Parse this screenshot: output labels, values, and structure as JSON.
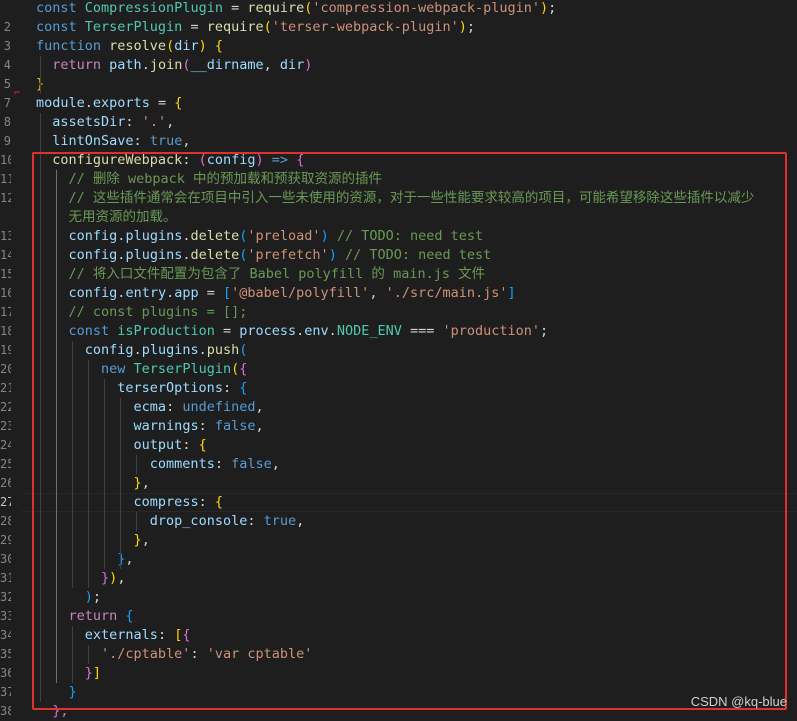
{
  "editor": {
    "current_line": "27",
    "lines": [
      {
        "n": "",
        "tokens": [
          [
            "k",
            "const "
          ],
          [
            "c",
            "CompressionPlugin"
          ],
          [
            "p",
            " = "
          ],
          [
            "f",
            "require"
          ],
          [
            "b1",
            "("
          ],
          [
            "s",
            "'compression-webpack-plugin'"
          ],
          [
            "b1",
            ")"
          ],
          [
            "p",
            ";"
          ]
        ]
      },
      {
        "n": "2",
        "tokens": [
          [
            "k",
            "const "
          ],
          [
            "c",
            "TerserPlugin"
          ],
          [
            "p",
            " = "
          ],
          [
            "f",
            "require"
          ],
          [
            "b1",
            "("
          ],
          [
            "s",
            "'terser-webpack-plugin'"
          ],
          [
            "b1",
            ")"
          ],
          [
            "p",
            ";"
          ]
        ]
      },
      {
        "n": "3",
        "tokens": [
          [
            "k",
            "function "
          ],
          [
            "f",
            "resolve"
          ],
          [
            "b1",
            "("
          ],
          [
            "v",
            "dir"
          ],
          [
            "b1",
            ")"
          ],
          [
            "p",
            " "
          ],
          [
            "b1",
            "{"
          ]
        ]
      },
      {
        "n": "4",
        "tokens": [
          [
            "p",
            "  "
          ],
          [
            "kc",
            "return "
          ],
          [
            "v",
            "path"
          ],
          [
            "p",
            "."
          ],
          [
            "f",
            "join"
          ],
          [
            "b2",
            "("
          ],
          [
            "v",
            "__dirname"
          ],
          [
            "p",
            ", "
          ],
          [
            "v",
            "dir"
          ],
          [
            "b2",
            ")"
          ]
        ]
      },
      {
        "n": "5",
        "tokens": [
          [
            "b1",
            "}"
          ]
        ]
      },
      {
        "n": "7",
        "tokens": [
          [
            "v",
            "module"
          ],
          [
            "p",
            "."
          ],
          [
            "v",
            "exports"
          ],
          [
            "p",
            " = "
          ],
          [
            "b1",
            "{"
          ]
        ]
      },
      {
        "n": "8",
        "tokens": [
          [
            "p",
            "  "
          ],
          [
            "v",
            "assetsDir"
          ],
          [
            "p",
            ": "
          ],
          [
            "s",
            "'.'"
          ],
          [
            "p",
            ","
          ]
        ]
      },
      {
        "n": "9",
        "tokens": [
          [
            "p",
            "  "
          ],
          [
            "v",
            "lintOnSave"
          ],
          [
            "p",
            ": "
          ],
          [
            "k",
            "true"
          ],
          [
            "p",
            ","
          ]
        ]
      },
      {
        "n": "10",
        "tokens": [
          [
            "p",
            "  "
          ],
          [
            "f",
            "configureWebpack"
          ],
          [
            "p",
            ": "
          ],
          [
            "b2",
            "("
          ],
          [
            "v",
            "config"
          ],
          [
            "b2",
            ")"
          ],
          [
            "p",
            " "
          ],
          [
            "k",
            "=>"
          ],
          [
            "p",
            " "
          ],
          [
            "b2",
            "{"
          ]
        ]
      },
      {
        "n": "11",
        "tokens": [
          [
            "cm",
            "    // 删除 webpack 中的预加载和预获取资源的插件"
          ]
        ]
      },
      {
        "n": "12",
        "tokens": [
          [
            "cm",
            "    // 这些插件通常会在项目中引入一些未使用的资源，对于一些性能要求较高的项目，可能希望移除这些插件以减少"
          ]
        ]
      },
      {
        "n": "",
        "tokens": [
          [
            "cm",
            "    无用资源的加载。"
          ]
        ]
      },
      {
        "n": "13",
        "tokens": [
          [
            "p",
            "    "
          ],
          [
            "v",
            "config"
          ],
          [
            "p",
            "."
          ],
          [
            "v",
            "plugins"
          ],
          [
            "p",
            "."
          ],
          [
            "f",
            "delete"
          ],
          [
            "b3",
            "("
          ],
          [
            "s",
            "'preload'"
          ],
          [
            "b3",
            ")"
          ],
          [
            "cm",
            " // TODO: need test"
          ]
        ]
      },
      {
        "n": "14",
        "tokens": [
          [
            "p",
            "    "
          ],
          [
            "v",
            "config"
          ],
          [
            "p",
            "."
          ],
          [
            "v",
            "plugins"
          ],
          [
            "p",
            "."
          ],
          [
            "f",
            "delete"
          ],
          [
            "b3",
            "("
          ],
          [
            "s",
            "'prefetch'"
          ],
          [
            "b3",
            ")"
          ],
          [
            "cm",
            " // TODO: need test"
          ]
        ]
      },
      {
        "n": "15",
        "tokens": [
          [
            "cm",
            "    // 将入口文件配置为包含了 Babel polyfill 的 main.js 文件"
          ]
        ]
      },
      {
        "n": "16",
        "tokens": [
          [
            "p",
            "    "
          ],
          [
            "v",
            "config"
          ],
          [
            "p",
            "."
          ],
          [
            "v",
            "entry"
          ],
          [
            "p",
            "."
          ],
          [
            "v",
            "app"
          ],
          [
            "p",
            " = "
          ],
          [
            "b3",
            "["
          ],
          [
            "s",
            "'@babel/polyfill'"
          ],
          [
            "p",
            ", "
          ],
          [
            "s",
            "'./src/main.js'"
          ],
          [
            "b3",
            "]"
          ]
        ]
      },
      {
        "n": "17",
        "tokens": [
          [
            "cm",
            "    // const plugins = [];"
          ]
        ]
      },
      {
        "n": "18",
        "tokens": [
          [
            "p",
            "    "
          ],
          [
            "k",
            "const "
          ],
          [
            "c",
            "isProduction"
          ],
          [
            "p",
            " = "
          ],
          [
            "v",
            "process"
          ],
          [
            "p",
            "."
          ],
          [
            "v",
            "env"
          ],
          [
            "p",
            "."
          ],
          [
            "c",
            "NODE_ENV"
          ],
          [
            "p",
            " === "
          ],
          [
            "s",
            "'production'"
          ],
          [
            "p",
            ";"
          ]
        ]
      },
      {
        "n": "19",
        "tokens": [
          [
            "p",
            "      "
          ],
          [
            "v",
            "config"
          ],
          [
            "p",
            "."
          ],
          [
            "v",
            "plugins"
          ],
          [
            "p",
            "."
          ],
          [
            "f",
            "push"
          ],
          [
            "b3",
            "("
          ]
        ]
      },
      {
        "n": "20",
        "tokens": [
          [
            "p",
            "        "
          ],
          [
            "k",
            "new "
          ],
          [
            "c",
            "TerserPlugin"
          ],
          [
            "b1",
            "("
          ],
          [
            "b2",
            "{"
          ]
        ]
      },
      {
        "n": "21",
        "tokens": [
          [
            "p",
            "          "
          ],
          [
            "v",
            "terserOptions"
          ],
          [
            "p",
            ": "
          ],
          [
            "b3",
            "{"
          ]
        ]
      },
      {
        "n": "22",
        "tokens": [
          [
            "p",
            "            "
          ],
          [
            "v",
            "ecma"
          ],
          [
            "p",
            ": "
          ],
          [
            "k",
            "undefined"
          ],
          [
            "p",
            ","
          ]
        ]
      },
      {
        "n": "23",
        "tokens": [
          [
            "p",
            "            "
          ],
          [
            "v",
            "warnings"
          ],
          [
            "p",
            ": "
          ],
          [
            "k",
            "false"
          ],
          [
            "p",
            ","
          ]
        ]
      },
      {
        "n": "24",
        "tokens": [
          [
            "p",
            "            "
          ],
          [
            "v",
            "output"
          ],
          [
            "p",
            ": "
          ],
          [
            "b1",
            "{"
          ]
        ]
      },
      {
        "n": "25",
        "tokens": [
          [
            "p",
            "              "
          ],
          [
            "v",
            "comments"
          ],
          [
            "p",
            ": "
          ],
          [
            "k",
            "false"
          ],
          [
            "p",
            ","
          ]
        ]
      },
      {
        "n": "26",
        "tokens": [
          [
            "p",
            "            "
          ],
          [
            "b1",
            "}"
          ],
          [
            "p",
            ","
          ]
        ]
      },
      {
        "n": "27",
        "tokens": [
          [
            "p",
            "            "
          ],
          [
            "v",
            "compress"
          ],
          [
            "p",
            ": "
          ],
          [
            "b1",
            "{"
          ]
        ]
      },
      {
        "n": "28",
        "tokens": [
          [
            "p",
            "              "
          ],
          [
            "v",
            "drop_console"
          ],
          [
            "p",
            ": "
          ],
          [
            "k",
            "true"
          ],
          [
            "p",
            ","
          ]
        ]
      },
      {
        "n": "29",
        "tokens": [
          [
            "p",
            "            "
          ],
          [
            "b1",
            "}"
          ],
          [
            "p",
            ","
          ]
        ]
      },
      {
        "n": "30",
        "tokens": [
          [
            "p",
            "          "
          ],
          [
            "b3",
            "}"
          ],
          [
            "p",
            ","
          ]
        ]
      },
      {
        "n": "31",
        "tokens": [
          [
            "p",
            "        "
          ],
          [
            "b2",
            "}"
          ],
          [
            "b1",
            ")"
          ],
          [
            "p",
            ","
          ]
        ]
      },
      {
        "n": "32",
        "tokens": [
          [
            "p",
            "      "
          ],
          [
            "b3",
            ")"
          ],
          [
            "p",
            ";"
          ]
        ]
      },
      {
        "n": "33",
        "tokens": [
          [
            "p",
            "    "
          ],
          [
            "kc",
            "return "
          ],
          [
            "b3",
            "{"
          ]
        ]
      },
      {
        "n": "34",
        "tokens": [
          [
            "p",
            "      "
          ],
          [
            "v",
            "externals"
          ],
          [
            "p",
            ": "
          ],
          [
            "b1",
            "["
          ],
          [
            "b2",
            "{"
          ]
        ]
      },
      {
        "n": "35",
        "tokens": [
          [
            "p",
            "        "
          ],
          [
            "s",
            "'./cptable'"
          ],
          [
            "p",
            ": "
          ],
          [
            "s",
            "'var cptable'"
          ]
        ]
      },
      {
        "n": "36",
        "tokens": [
          [
            "p",
            "      "
          ],
          [
            "b2",
            "}"
          ],
          [
            "b1",
            "]"
          ]
        ]
      },
      {
        "n": "37",
        "tokens": [
          [
            "p",
            "    "
          ],
          [
            "b3",
            "}"
          ]
        ]
      },
      {
        "n": "38",
        "tokens": [
          [
            "p",
            "  "
          ],
          [
            "b2",
            "},"
          ]
        ]
      }
    ]
  },
  "watermark": "CSDN @kq-blue"
}
